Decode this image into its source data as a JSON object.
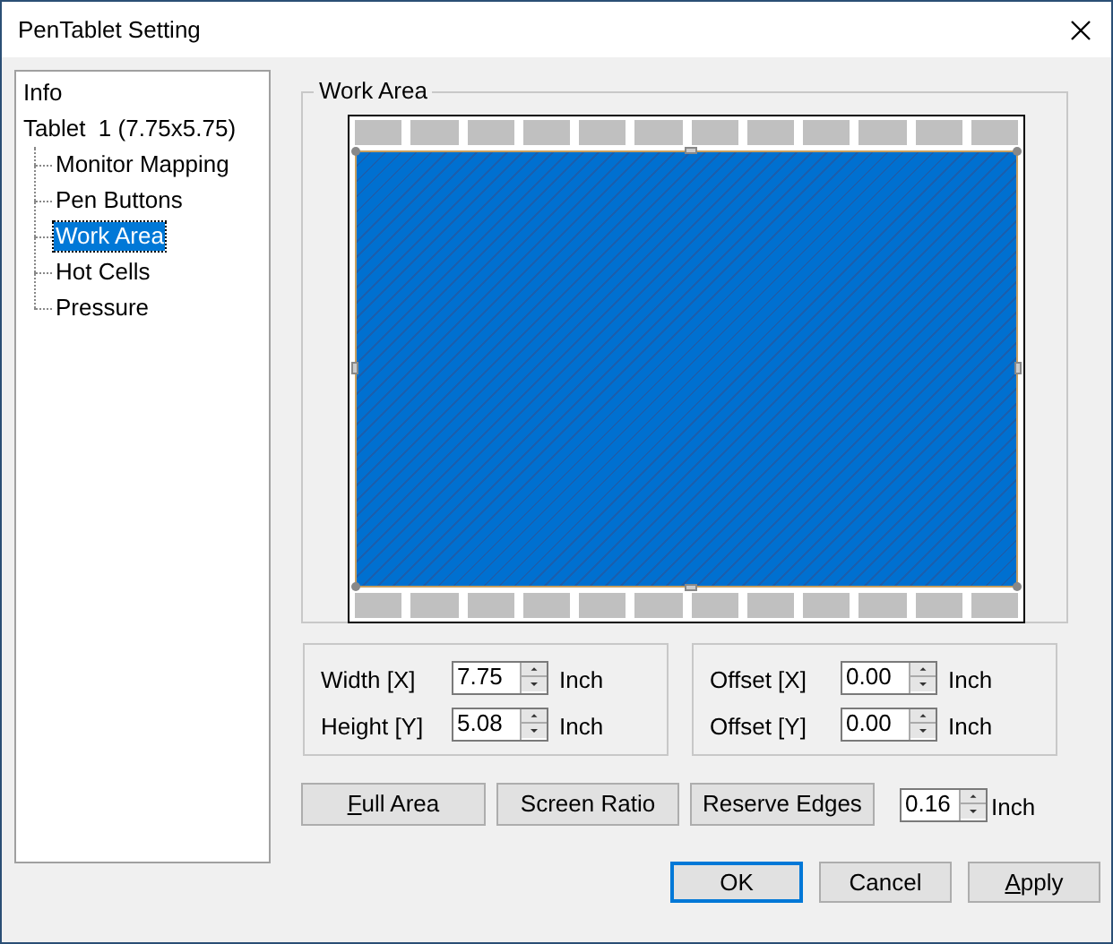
{
  "window": {
    "title": "PenTablet Setting"
  },
  "tree": [
    {
      "label": "Info",
      "selected": false
    },
    {
      "label": "Tablet  1 (7.75x5.75)",
      "selected": false,
      "children": [
        {
          "label": "Monitor Mapping",
          "selected": false
        },
        {
          "label": "Pen Buttons",
          "selected": false
        },
        {
          "label": "Work Area",
          "selected": true
        },
        {
          "label": "Hot Cells",
          "selected": false
        },
        {
          "label": "Pressure",
          "selected": false
        }
      ]
    }
  ],
  "work_area": {
    "title": "Work Area"
  },
  "size_fields": [
    {
      "label": "Width [X]",
      "value": "7.75",
      "unit": "Inch"
    },
    {
      "label": "Height [Y]",
      "value": "5.08",
      "unit": "Inch"
    }
  ],
  "offset_fields": [
    {
      "label": "Offset [X]",
      "value": "0.00",
      "unit": "Inch"
    },
    {
      "label": "Offset [Y]",
      "value": "0.00",
      "unit": "Inch"
    }
  ],
  "area_buttons": [
    {
      "label": "Full Area",
      "first_letter_underlined": true
    },
    {
      "label": "Screen Ratio"
    },
    {
      "label": "Reserve Edges"
    }
  ],
  "edge_field": {
    "value": "0.16",
    "unit": "Inch"
  },
  "dialog_buttons": [
    {
      "label": "OK"
    },
    {
      "label": "Cancel"
    },
    {
      "label": "Apply",
      "first_letter_underlined": true
    }
  ]
}
